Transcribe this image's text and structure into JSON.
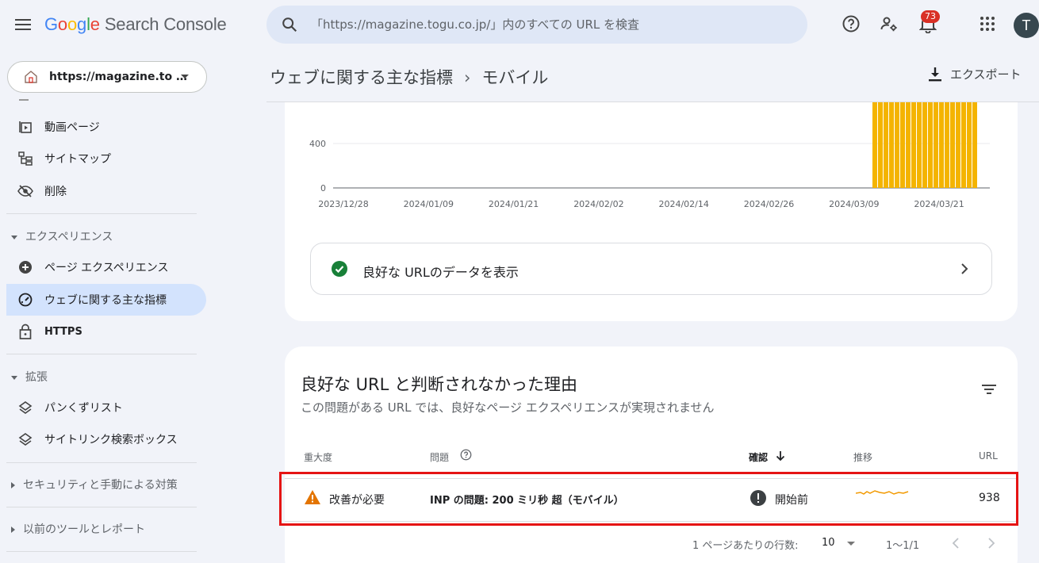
{
  "header": {
    "logo_google": [
      "G",
      "o",
      "o",
      "g",
      "l",
      "e"
    ],
    "product": "Search Console",
    "search_placeholder": "「https://magazine.togu.co.jp/」内のすべての URL を検査",
    "notification_count": "73",
    "avatar_initial": "T"
  },
  "sidebar": {
    "property": "https://magazine.to …",
    "items_top": [
      {
        "label": "動画ページ",
        "icon": "video-page-icon"
      },
      {
        "label": "サイトマップ",
        "icon": "sitemap-icon"
      },
      {
        "label": "削除",
        "icon": "removal-icon"
      }
    ],
    "section_experience": "エクスペリエンス",
    "items_experience": [
      {
        "label": "ページ エクスペリエンス",
        "icon": "plus-circle-icon"
      },
      {
        "label": "ウェブに関する主な指標",
        "icon": "gauge-icon"
      },
      {
        "label": "HTTPS",
        "icon": "lock-icon"
      }
    ],
    "section_enhancements": "拡張",
    "items_enhancements": [
      {
        "label": "パンくずリスト",
        "icon": "layers-icon"
      },
      {
        "label": "サイトリンク検索ボックス",
        "icon": "layers-icon"
      }
    ],
    "section_security": "セキュリティと手動による対策",
    "section_legacy": "以前のツールとレポート"
  },
  "main": {
    "breadcrumb": [
      "ウェブに関する主な指標",
      "モバイル"
    ],
    "export_label": "エクスポート",
    "good_url_link": "良好な URLのデータを表示",
    "issues": {
      "title": "良好な URL と判断されなかった理由",
      "subtitle": "この問題がある URL では、良好なページ エクスペリエンスが実現されません",
      "columns": [
        "重大度",
        "問題",
        "確認",
        "推移",
        "URL"
      ],
      "rows": [
        {
          "severity": "改善が必要",
          "issue": "INP の問題: 200 ミリ秒 超（モバイル）",
          "validation": "開始前",
          "urls": "938"
        }
      ],
      "pager": {
        "rows_per_page_label": "1 ページあたりの行数:",
        "rows_per_page": "10",
        "range": "1〜1/1"
      }
    }
  },
  "chart_data": {
    "type": "bar",
    "x_tick_labels": [
      "2023/12/28",
      "2024/01/09",
      "2024/01/21",
      "2024/02/02",
      "2024/02/14",
      "2024/02/26",
      "2024/03/09",
      "2024/03/21"
    ],
    "y_tick_labels": [
      "0",
      "400"
    ],
    "color": "#f4b400",
    "bars_start_index": 73,
    "total_days": 93,
    "visible_bar_count": 19,
    "note_values": "bars exceed visible y range (clipped at top)"
  }
}
